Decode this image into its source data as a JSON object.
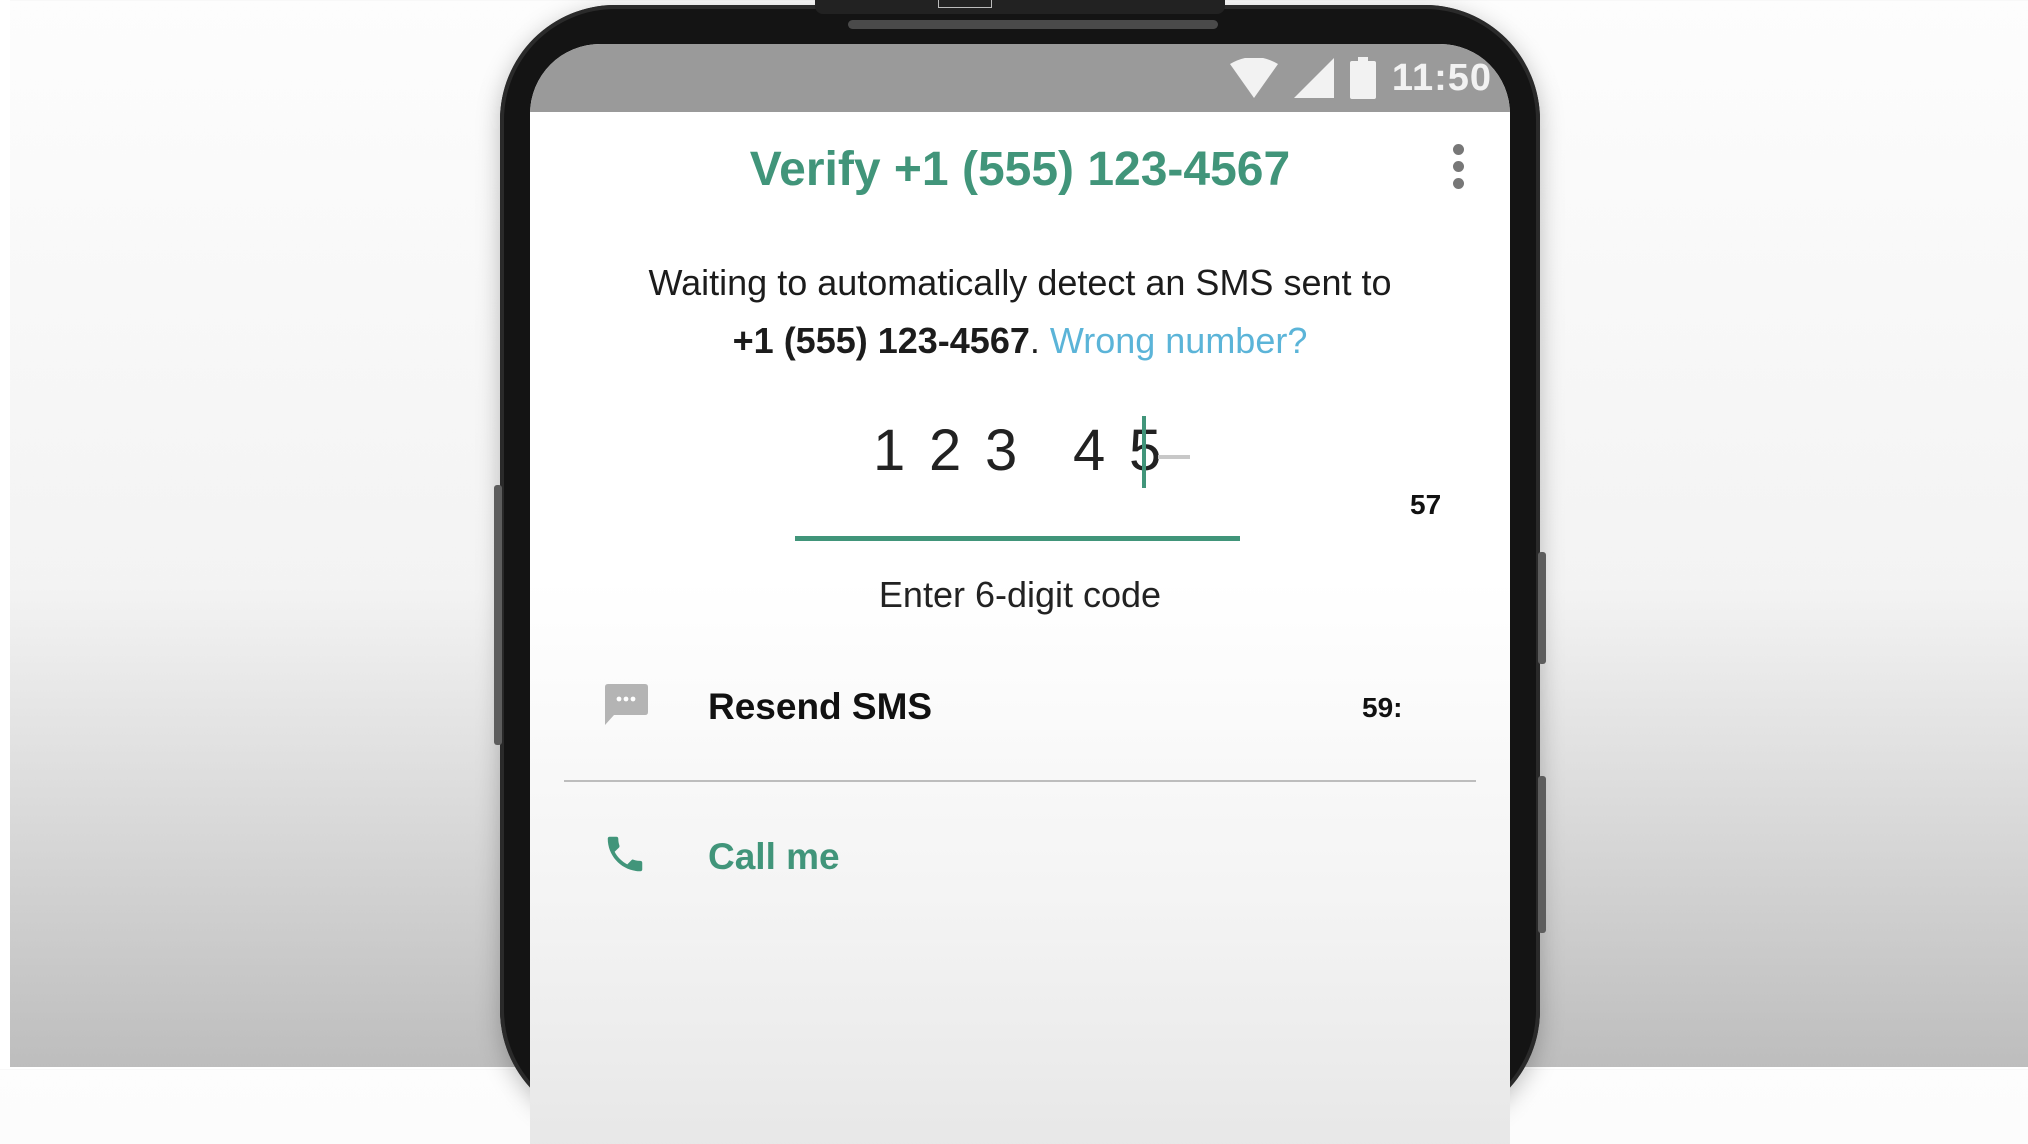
{
  "status_bar": {
    "time": "11:50",
    "icons": [
      "wifi-icon",
      "signal-icon",
      "battery-icon"
    ]
  },
  "header": {
    "title": "Verify +1 (555) 123-4567",
    "menu_icon": "overflow-menu-icon"
  },
  "message": {
    "line1": "Waiting to automatically detect an SMS sent to",
    "phone": "+1 (555) 123-4567",
    "separator": ". ",
    "wrong_number_link": "Wrong number?"
  },
  "code_input": {
    "digits": [
      "1",
      "2",
      "3",
      "4",
      "5"
    ],
    "hint": "Enter 6-digit code"
  },
  "overlay_badge": "57",
  "actions": {
    "resend_sms": {
      "label": "Resend SMS",
      "timer": "59:",
      "icon": "message-icon"
    },
    "call_me": {
      "label": "Call me",
      "icon": "phone-icon"
    }
  },
  "colors": {
    "accent": "#41957a",
    "link": "#5bb4d8",
    "statusbar": "#9a9a9a"
  }
}
